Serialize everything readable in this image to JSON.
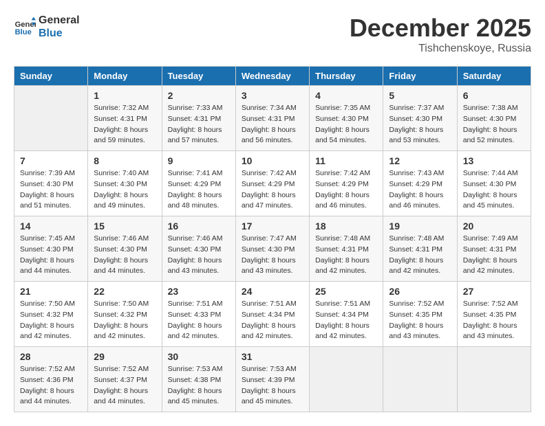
{
  "header": {
    "logo_line1": "General",
    "logo_line2": "Blue",
    "month_title": "December 2025",
    "location": "Tishchenskoye, Russia"
  },
  "days_of_week": [
    "Sunday",
    "Monday",
    "Tuesday",
    "Wednesday",
    "Thursday",
    "Friday",
    "Saturday"
  ],
  "weeks": [
    [
      {
        "num": "",
        "info": ""
      },
      {
        "num": "1",
        "info": "Sunrise: 7:32 AM\nSunset: 4:31 PM\nDaylight: 8 hours\nand 59 minutes."
      },
      {
        "num": "2",
        "info": "Sunrise: 7:33 AM\nSunset: 4:31 PM\nDaylight: 8 hours\nand 57 minutes."
      },
      {
        "num": "3",
        "info": "Sunrise: 7:34 AM\nSunset: 4:31 PM\nDaylight: 8 hours\nand 56 minutes."
      },
      {
        "num": "4",
        "info": "Sunrise: 7:35 AM\nSunset: 4:30 PM\nDaylight: 8 hours\nand 54 minutes."
      },
      {
        "num": "5",
        "info": "Sunrise: 7:37 AM\nSunset: 4:30 PM\nDaylight: 8 hours\nand 53 minutes."
      },
      {
        "num": "6",
        "info": "Sunrise: 7:38 AM\nSunset: 4:30 PM\nDaylight: 8 hours\nand 52 minutes."
      }
    ],
    [
      {
        "num": "7",
        "info": "Sunrise: 7:39 AM\nSunset: 4:30 PM\nDaylight: 8 hours\nand 51 minutes."
      },
      {
        "num": "8",
        "info": "Sunrise: 7:40 AM\nSunset: 4:30 PM\nDaylight: 8 hours\nand 49 minutes."
      },
      {
        "num": "9",
        "info": "Sunrise: 7:41 AM\nSunset: 4:29 PM\nDaylight: 8 hours\nand 48 minutes."
      },
      {
        "num": "10",
        "info": "Sunrise: 7:42 AM\nSunset: 4:29 PM\nDaylight: 8 hours\nand 47 minutes."
      },
      {
        "num": "11",
        "info": "Sunrise: 7:42 AM\nSunset: 4:29 PM\nDaylight: 8 hours\nand 46 minutes."
      },
      {
        "num": "12",
        "info": "Sunrise: 7:43 AM\nSunset: 4:29 PM\nDaylight: 8 hours\nand 46 minutes."
      },
      {
        "num": "13",
        "info": "Sunrise: 7:44 AM\nSunset: 4:30 PM\nDaylight: 8 hours\nand 45 minutes."
      }
    ],
    [
      {
        "num": "14",
        "info": "Sunrise: 7:45 AM\nSunset: 4:30 PM\nDaylight: 8 hours\nand 44 minutes."
      },
      {
        "num": "15",
        "info": "Sunrise: 7:46 AM\nSunset: 4:30 PM\nDaylight: 8 hours\nand 44 minutes."
      },
      {
        "num": "16",
        "info": "Sunrise: 7:46 AM\nSunset: 4:30 PM\nDaylight: 8 hours\nand 43 minutes."
      },
      {
        "num": "17",
        "info": "Sunrise: 7:47 AM\nSunset: 4:30 PM\nDaylight: 8 hours\nand 43 minutes."
      },
      {
        "num": "18",
        "info": "Sunrise: 7:48 AM\nSunset: 4:31 PM\nDaylight: 8 hours\nand 42 minutes."
      },
      {
        "num": "19",
        "info": "Sunrise: 7:48 AM\nSunset: 4:31 PM\nDaylight: 8 hours\nand 42 minutes."
      },
      {
        "num": "20",
        "info": "Sunrise: 7:49 AM\nSunset: 4:31 PM\nDaylight: 8 hours\nand 42 minutes."
      }
    ],
    [
      {
        "num": "21",
        "info": "Sunrise: 7:50 AM\nSunset: 4:32 PM\nDaylight: 8 hours\nand 42 minutes."
      },
      {
        "num": "22",
        "info": "Sunrise: 7:50 AM\nSunset: 4:32 PM\nDaylight: 8 hours\nand 42 minutes."
      },
      {
        "num": "23",
        "info": "Sunrise: 7:51 AM\nSunset: 4:33 PM\nDaylight: 8 hours\nand 42 minutes."
      },
      {
        "num": "24",
        "info": "Sunrise: 7:51 AM\nSunset: 4:34 PM\nDaylight: 8 hours\nand 42 minutes."
      },
      {
        "num": "25",
        "info": "Sunrise: 7:51 AM\nSunset: 4:34 PM\nDaylight: 8 hours\nand 42 minutes."
      },
      {
        "num": "26",
        "info": "Sunrise: 7:52 AM\nSunset: 4:35 PM\nDaylight: 8 hours\nand 43 minutes."
      },
      {
        "num": "27",
        "info": "Sunrise: 7:52 AM\nSunset: 4:35 PM\nDaylight: 8 hours\nand 43 minutes."
      }
    ],
    [
      {
        "num": "28",
        "info": "Sunrise: 7:52 AM\nSunset: 4:36 PM\nDaylight: 8 hours\nand 44 minutes."
      },
      {
        "num": "29",
        "info": "Sunrise: 7:52 AM\nSunset: 4:37 PM\nDaylight: 8 hours\nand 44 minutes."
      },
      {
        "num": "30",
        "info": "Sunrise: 7:53 AM\nSunset: 4:38 PM\nDaylight: 8 hours\nand 45 minutes."
      },
      {
        "num": "31",
        "info": "Sunrise: 7:53 AM\nSunset: 4:39 PM\nDaylight: 8 hours\nand 45 minutes."
      },
      {
        "num": "",
        "info": ""
      },
      {
        "num": "",
        "info": ""
      },
      {
        "num": "",
        "info": ""
      }
    ]
  ]
}
